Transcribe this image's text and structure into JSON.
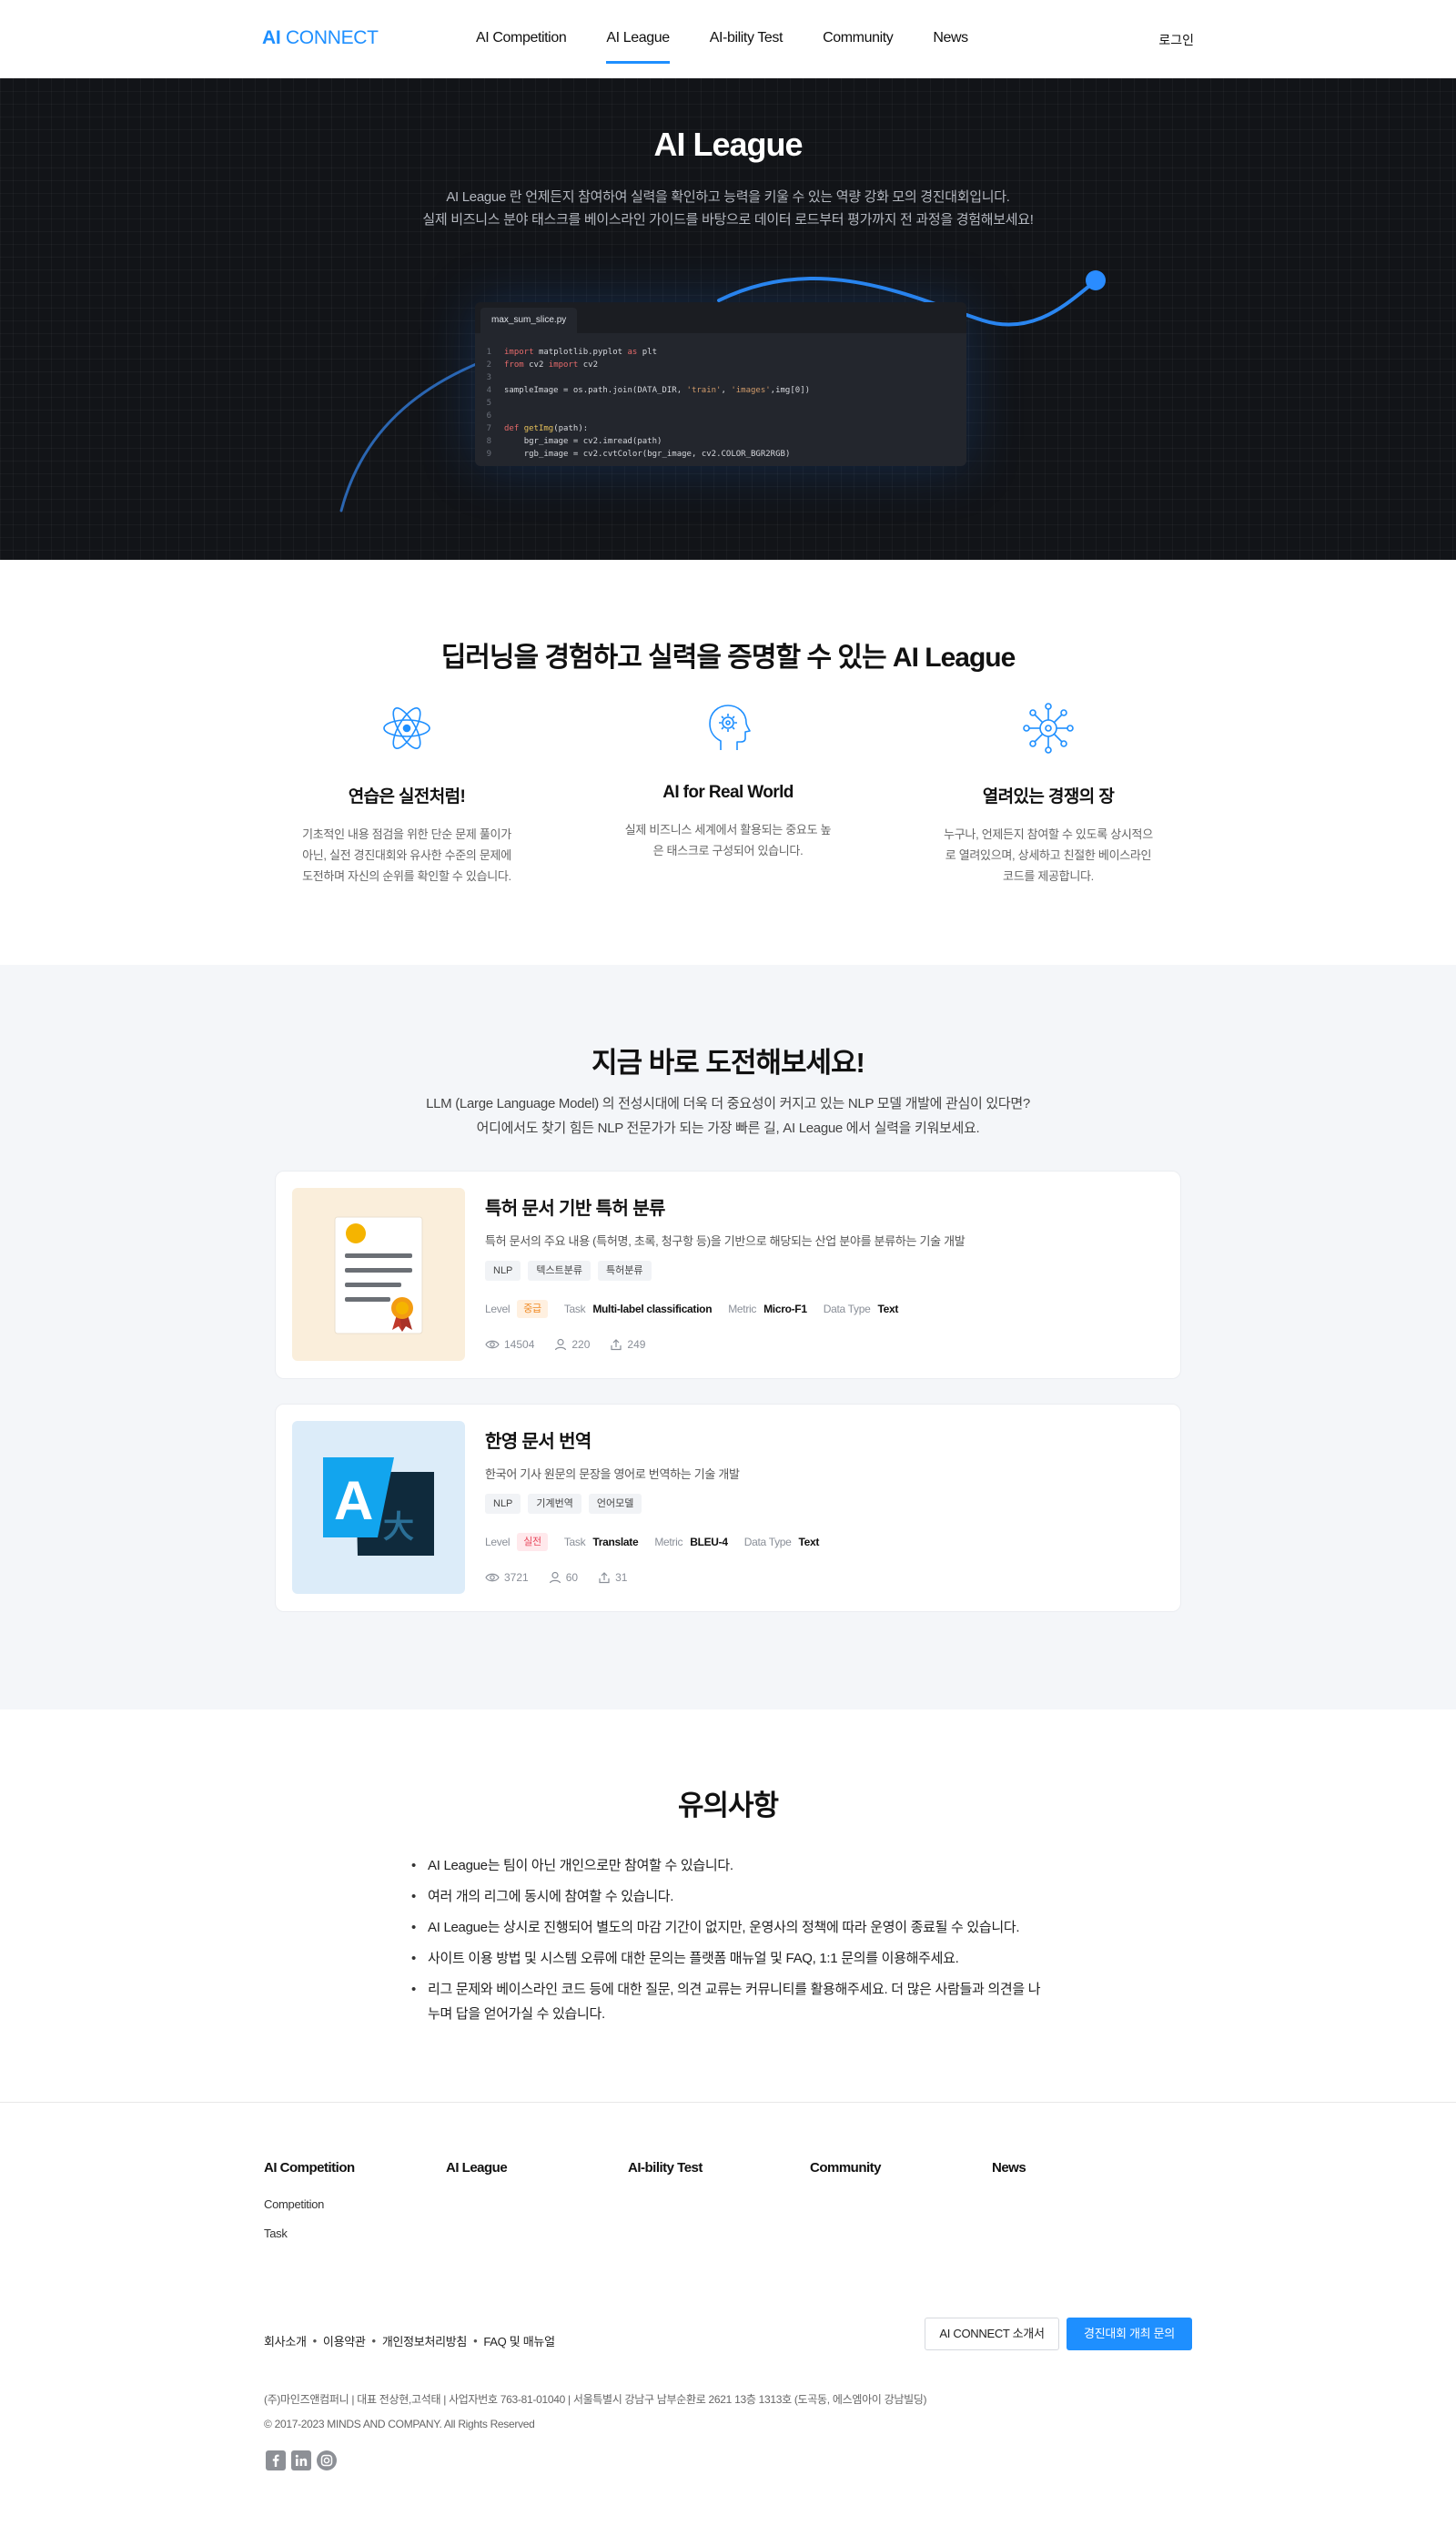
{
  "header": {
    "logo_strong": "AI",
    "logo_rest": " CONNECT",
    "nav": [
      {
        "label": "AI Competition"
      },
      {
        "label": "AI League"
      },
      {
        "label": "AI-bility Test"
      },
      {
        "label": "Community"
      },
      {
        "label": "News"
      }
    ],
    "active_nav": "AI League",
    "login": "로그인"
  },
  "hero": {
    "title": "AI League",
    "desc_line1": "AI League 란 언제든지 참여하여 실력을 확인하고 능력을 키울 수 있는 역량 강화 모의 경진대회입니다.",
    "desc_line2": "실제 비즈니스 분야 태스크를 베이스라인 가이드를 바탕으로 데이터 로드부터 평가까지 전 과정을 경험해보세요!",
    "code_tab": "max_sum_slice.py",
    "code_lines": [
      {
        "num": "1",
        "text": "import matplotlib.pyplot as plt"
      },
      {
        "num": "2",
        "text": "from cv2 import cv2"
      },
      {
        "num": "3",
        "text": ""
      },
      {
        "num": "4",
        "text": "sampleImage = os.path.join(DATA_DIR, 'train', 'images',img[0])"
      },
      {
        "num": "5",
        "text": ""
      },
      {
        "num": "6",
        "text": ""
      },
      {
        "num": "7",
        "text": "def getImg(path):"
      },
      {
        "num": "8",
        "text": "    bgr_image = cv2.imread(path)"
      },
      {
        "num": "9",
        "text": "    rgb_image = cv2.cvtColor(bgr_image, cv2.COLOR_BGR2RGB)"
      }
    ]
  },
  "features": {
    "title": "딥러닝을 경험하고 실력을 증명할 수 있는 AI League",
    "items": [
      {
        "icon": "atom-icon",
        "title": "연습은 실전처럼!",
        "lines": [
          "기초적인 내용 점검을 위한 단순 문제 풀이가",
          "아닌, 실전 경진대회와 유사한 수준의 문제에",
          "도전하며 자신의 순위를 확인할 수 있습니다."
        ]
      },
      {
        "icon": "brain-gear-icon",
        "title": "AI for Real World",
        "lines": [
          "실제 비즈니스 세계에서 활용되는 중요도 높",
          "은 태스크로 구성되어 있습니다."
        ]
      },
      {
        "icon": "network-hub-icon",
        "title": "열려있는 경쟁의 장",
        "lines": [
          "누구나, 언제든지 참여할 수 있도록 상시적으",
          "로 열려있으며, 상세하고 친절한 베이스라인",
          "코드를 제공합니다."
        ]
      }
    ]
  },
  "challenge": {
    "title": "지금 바로 도전해보세요!",
    "desc_line1": "LLM (Large Language Model) 의 전성시대에 더욱 더 중요성이 커지고 있는 NLP 모델 개발에 관심이 있다면?",
    "desc_line2": "어디에서도 찾기 힘든 NLP 전문가가 되는 가장 빠른 길, AI League 에서 실력을 키워보세요.",
    "meta_labels": {
      "level": "Level",
      "task": "Task",
      "metric": "Metric",
      "data_type": "Data Type"
    },
    "cards": [
      {
        "thumb_icon": "certificate-icon",
        "title": "특허 문서 기반 특허 분류",
        "desc": "특허 문서의 주요 내용 (특허명, 초록, 청구항 등)을 기반으로 해당되는 산업 분야를 분류하는 기술 개발",
        "tags": [
          "NLP",
          "텍스트분류",
          "특허분류"
        ],
        "level": "중급",
        "task": "Multi-label classification",
        "metric": "Micro-F1",
        "data_type": "Text",
        "views": "14504",
        "participants": "220",
        "submissions": "249"
      },
      {
        "thumb_icon": "translate-icon",
        "title": "한영 문서 번역",
        "desc": "한국어 기사 원문의 문장을 영어로 번역하는 기술 개발",
        "tags": [
          "NLP",
          "기계번역",
          "언어모델"
        ],
        "level": "실전",
        "task": "Translate",
        "metric": "BLEU-4",
        "data_type": "Text",
        "views": "3721",
        "participants": "60",
        "submissions": "31"
      }
    ]
  },
  "notice": {
    "title": "유의사항",
    "items": [
      "AI League는 팀이 아닌 개인으로만 참여할 수 있습니다.",
      "여러 개의 리그에 동시에 참여할 수 있습니다.",
      "AI League는 상시로 진행되어 별도의 마감 기간이 없지만, 운영사의 정책에 따라 운영이 종료될 수 있습니다.",
      "사이트 이용 방법 및 시스템 오류에 대한 문의는 플랫폼 매뉴얼 및 FAQ, 1:1 문의를 이용해주세요.",
      "리그 문제와 베이스라인 코드 등에 대한 질문, 의견 교류는 커뮤니티를 활용해주세요. 더 많은 사람들과 의견을 나누며 답을 얻어가실 수 있습니다."
    ]
  },
  "footer": {
    "columns": [
      "AI Competition",
      "AI League",
      "AI-bility Test",
      "Community",
      "News"
    ],
    "sub_links": [
      "Competition",
      "Task"
    ],
    "bottom_links": [
      "회사소개",
      "이용약관",
      "개인정보처리방침",
      "FAQ 및 매뉴얼"
    ],
    "about_button": "AI CONNECT 소개서",
    "host_button": "경진대회 개최 문의",
    "company": "(주)마인즈앤컴퍼니 | 대표 전상현,고석태 | 사업자번호 763-81-01040 | 서울특별시 강남구 남부순환로 2621 13층 1313호 (도곡동, 에스엠아이 강남빌딩)",
    "copyright": "© 2017-2023 MINDS AND COMPANY. All Rights Reserved",
    "social": [
      "facebook-icon",
      "linkedin-icon",
      "instagram-icon"
    ]
  },
  "colors": {
    "accent": "#1e8fff",
    "hero_bg": "#121418",
    "section_bg": "#f4f6f9"
  }
}
